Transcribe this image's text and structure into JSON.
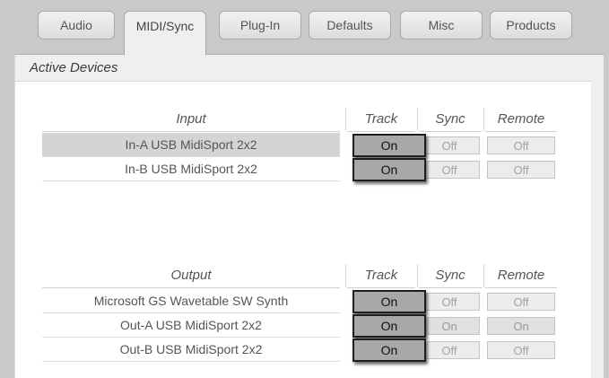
{
  "tabs": [
    {
      "label": "Audio",
      "active": false
    },
    {
      "label": "MIDI/Sync",
      "active": true
    },
    {
      "label": "Plug-In",
      "active": false
    },
    {
      "label": "Defaults",
      "active": false
    },
    {
      "label": "Misc",
      "active": false
    },
    {
      "label": "Products",
      "active": false
    }
  ],
  "section": {
    "title": "Active Devices"
  },
  "input_table": {
    "headers": {
      "name": "Input",
      "track": "Track",
      "sync": "Sync",
      "remote": "Remote"
    },
    "rows": [
      {
        "name": "In-A USB MidiSport 2x2",
        "track": "On",
        "sync": "Off",
        "remote": "Off",
        "selected": true
      },
      {
        "name": "In-B USB MidiSport 2x2",
        "track": "On",
        "sync": "Off",
        "remote": "Off",
        "selected": false
      }
    ]
  },
  "output_table": {
    "headers": {
      "name": "Output",
      "track": "Track",
      "sync": "Sync",
      "remote": "Remote"
    },
    "rows": [
      {
        "name": "Microsoft GS Wavetable SW Synth",
        "track": "On",
        "sync": "Off",
        "remote": "Off"
      },
      {
        "name": "Out-A USB MidiSport 2x2",
        "track": "On",
        "sync": "On",
        "remote": "On"
      },
      {
        "name": "Out-B USB MidiSport 2x2",
        "track": "On",
        "sync": "Off",
        "remote": "Off"
      }
    ]
  }
}
